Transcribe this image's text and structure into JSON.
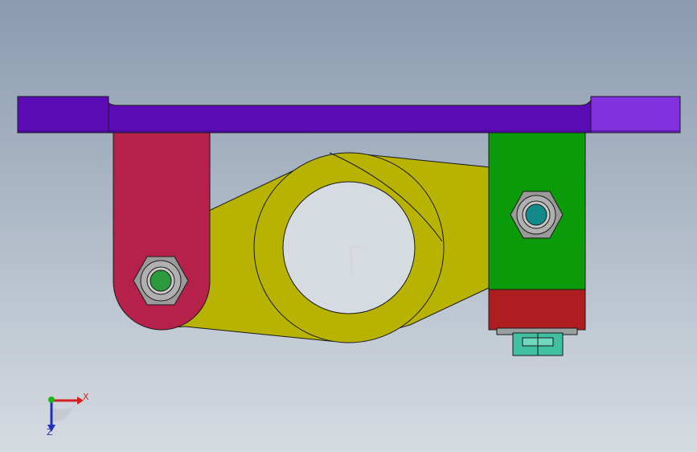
{
  "viewport": {
    "background_top": "#8a9bb0",
    "background_bottom": "#d6dbe1"
  },
  "parts": {
    "base_plate_color": "#5b0ab5",
    "base_plate_end_color": "#8230e0",
    "left_link_color": "#b5214a",
    "cam_arm_color": "#b7b300",
    "right_block_color": "#0a9a0a",
    "lower_block_color": "#b01d20",
    "clamp_color": "#40c0a0",
    "nut_color": "#9a9a9a",
    "left_pin_color": "#2e9a3e",
    "right_pin_color": "#128a8a",
    "outline_color": "#1a1a1a"
  },
  "triad": {
    "x_label": "X",
    "z_label": "Z",
    "x_color": "#d42020",
    "y_color": "#20b020",
    "z_color": "#2030c0"
  }
}
